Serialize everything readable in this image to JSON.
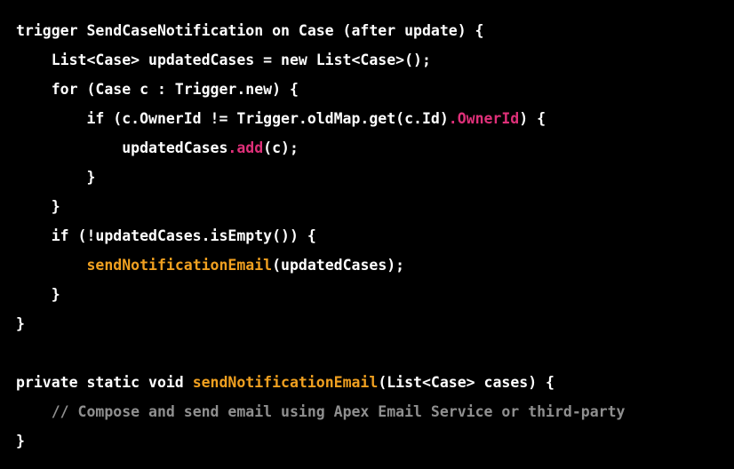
{
  "colors": {
    "background": "#000000",
    "default_text": "#ffffff",
    "method_pink": "#df3079",
    "function_orange": "#f0a020",
    "comment_gray": "#8f8f8f"
  },
  "code": {
    "lines": [
      [
        {
          "text": "trigger SendCaseNotification on Case (after update) {",
          "style": "white"
        }
      ],
      [
        {
          "text": "    List<Case> updatedCases = new List<Case>();",
          "style": "white"
        }
      ],
      [
        {
          "text": "    for (Case c : Trigger.new) {",
          "style": "white"
        }
      ],
      [
        {
          "text": "        if (c.OwnerId != Trigger.oldMap.get(c.Id)",
          "style": "white"
        },
        {
          "text": ".OwnerId",
          "style": "pink"
        },
        {
          "text": ") {",
          "style": "white"
        }
      ],
      [
        {
          "text": "            updatedCases",
          "style": "white"
        },
        {
          "text": ".add",
          "style": "pink"
        },
        {
          "text": "(c);",
          "style": "white"
        }
      ],
      [
        {
          "text": "        }",
          "style": "white"
        }
      ],
      [
        {
          "text": "    }",
          "style": "white"
        }
      ],
      [
        {
          "text": "    if (!updatedCases.isEmpty()) {",
          "style": "white"
        }
      ],
      [
        {
          "text": "        ",
          "style": "white"
        },
        {
          "text": "sendNotificationEmail",
          "style": "orange"
        },
        {
          "text": "(updatedCases);",
          "style": "white"
        }
      ],
      [
        {
          "text": "    }",
          "style": "white"
        }
      ],
      [
        {
          "text": "}",
          "style": "white"
        }
      ],
      [
        {
          "text": "",
          "style": "white"
        }
      ],
      [
        {
          "text": "private static void ",
          "style": "white"
        },
        {
          "text": "sendNotificationEmail",
          "style": "orange"
        },
        {
          "text": "(List<Case> cases) {",
          "style": "white"
        }
      ],
      [
        {
          "text": "    ",
          "style": "white"
        },
        {
          "text": "// Compose and send email using Apex Email Service or third-party",
          "style": "comment"
        }
      ],
      [
        {
          "text": "}",
          "style": "white"
        }
      ]
    ]
  }
}
